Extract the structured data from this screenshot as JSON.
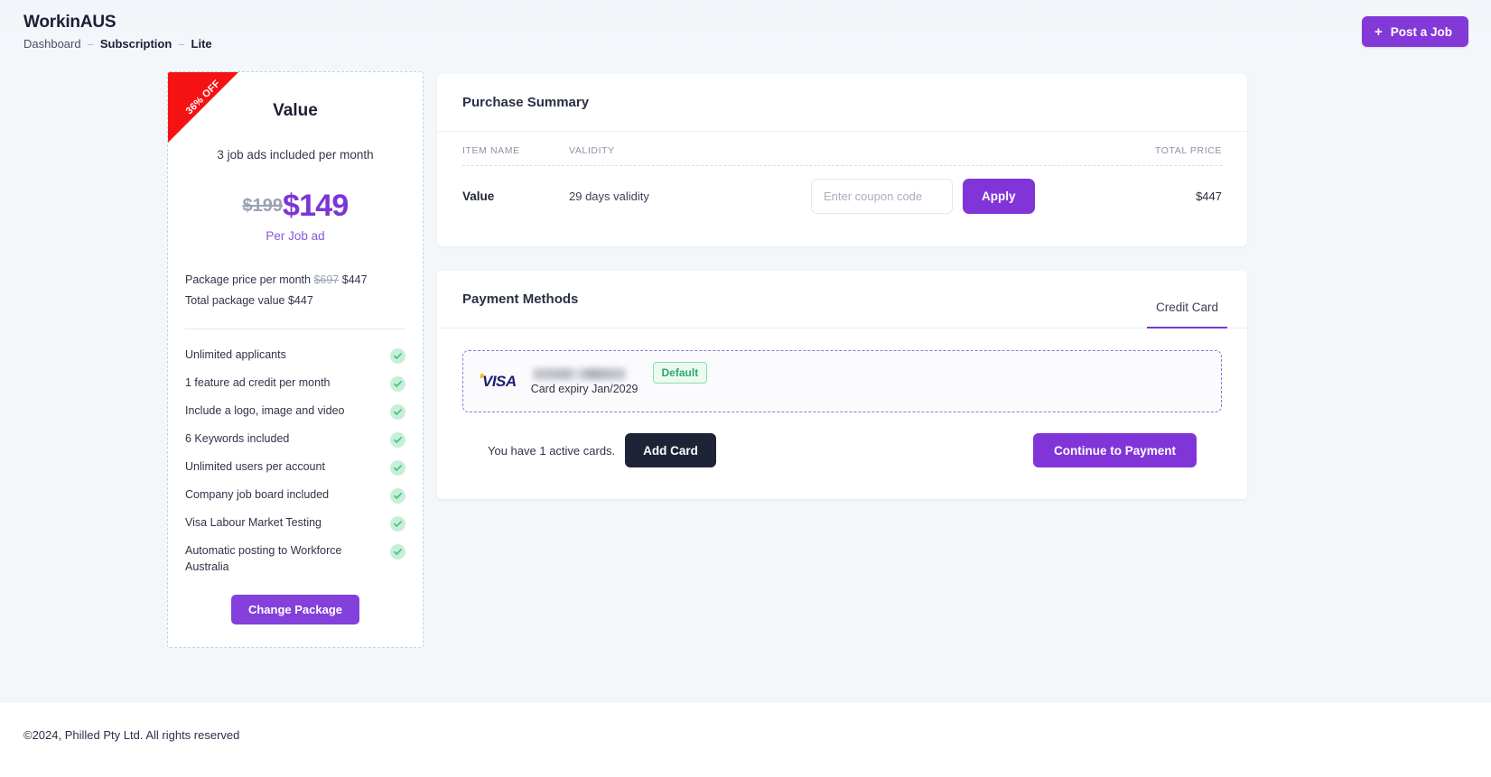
{
  "header": {
    "brand": "WorkinAUS",
    "breadcrumb": [
      {
        "label": "Dashboard",
        "bold": false
      },
      {
        "label": "Subscription",
        "bold": true
      },
      {
        "label": "Lite",
        "bold": true
      }
    ],
    "separator": "–",
    "post_job_label": "Post a Job",
    "post_job_icon": "plus-icon",
    "accent_color": "#8338d8"
  },
  "plan_card": {
    "ribbon": "36% OFF",
    "ribbon_color": "#f41212",
    "name": "Value",
    "subtitle": "3 job ads included per month",
    "price_old": "$199",
    "price_new": "$149",
    "price_unit": "Per Job ad",
    "price_color": "#7b35d6",
    "meta": [
      {
        "label": "Package price per month ",
        "strike": "$697",
        "value": "$447"
      },
      {
        "label": "Total package value $447",
        "strike": "",
        "value": ""
      }
    ],
    "meta_line_1_prefix": "Package price per month ",
    "meta_line_1_strike": "$697",
    "meta_line_1_value": "$447",
    "meta_line_2": "Total package value $447",
    "features": [
      "Unlimited applicants",
      "1 feature ad credit per month",
      "Include a logo, image and video",
      "6 Keywords included",
      "Unlimited users per account",
      "Company job board included",
      "Visa Labour Market Testing",
      "Automatic posting to Workforce Australia"
    ],
    "feature_icon": "check-icon",
    "change_package_label": "Change Package"
  },
  "purchase_summary": {
    "title": "Purchase Summary",
    "columns": [
      "ITEM NAME",
      "VALIDITY",
      "TOTAL PRICE"
    ],
    "rows": [
      {
        "item_name": "Value",
        "validity": "29 days validity",
        "total_price": "$447"
      }
    ],
    "coupon_placeholder": "Enter coupon code",
    "coupon_value": "",
    "apply_label": "Apply"
  },
  "payment_methods": {
    "title": "Payment Methods",
    "tabs": [
      {
        "label": "Credit Card",
        "active": true
      }
    ],
    "card": {
      "brand_logo": "visa-logo",
      "brand_label": "VISA",
      "number_masked": "",
      "expiry": "Card expiry Jan/2029",
      "badge": "Default",
      "badge_color": "#2fa86a"
    },
    "active_cards_text": "You have 1 active cards.",
    "add_card_label": "Add Card",
    "continue_label": "Continue to Payment"
  },
  "footer": {
    "copyright": "©2024, Philled Pty Ltd. All rights reserved"
  }
}
